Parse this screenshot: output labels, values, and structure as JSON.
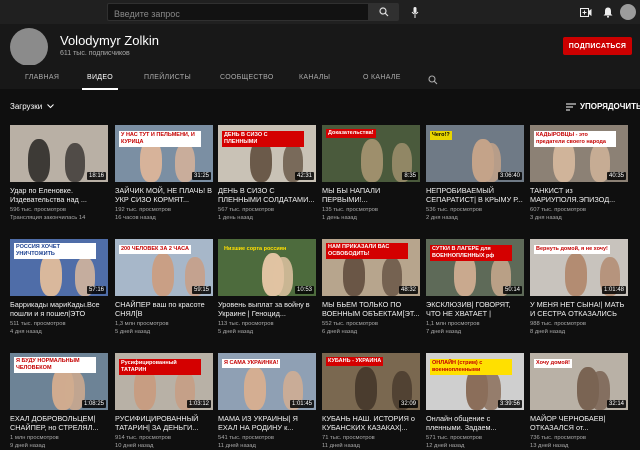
{
  "search": {
    "placeholder": "Введите запрос"
  },
  "channel": {
    "name": "Volodymyr Zolkin",
    "subscribers": "611 тыс. подписчиков",
    "subscribe_label": "ПОДПИСАТЬСЯ"
  },
  "tabs": [
    "ГЛАВНАЯ",
    "ВИДЕО",
    "ПЛЕЙЛИСТЫ",
    "СООБЩЕСТВО",
    "КАНАЛЫ",
    "О КАНАЛЕ"
  ],
  "sort": {
    "left": "Загрузки",
    "right": "УПОРЯДОЧИТЬ"
  },
  "videos": [
    {
      "title": "Удар по Еленовке. Издевательства над ...",
      "views": "596 тыс. просмотров",
      "age": "Трансляция закончилась 14",
      "duration": "18:16",
      "caption": ""
    },
    {
      "title": "ЗАЙЧИК МОЙ, НЕ ПЛАЧЬ! В УКР СИЗО КОРМЯТ...",
      "views": "192 тыс. просмотров",
      "age": "16 часов назад",
      "duration": "31:25",
      "caption": "У НАС ТУТ И ПЕЛЬМЕНИ, И КУРИЦА"
    },
    {
      "title": "ДЕНЬ В СИЗО С ПЛЕННЫМИ СОЛДАТАМИ...",
      "views": "567 тыс. просмотров",
      "age": "1 день назад",
      "duration": "42:31",
      "caption": "ДЕНЬ В СИЗО С ПЛЕННЫМИ"
    },
    {
      "title": "МЫ БЫ НАПАЛИ ПЕРВЫМИ!...",
      "views": "135 тыс. просмотров",
      "age": "1 день назад",
      "duration": "8:35",
      "caption": "Доказательства!"
    },
    {
      "title": "НЕПРОБИВАЕМЫЙ СЕПАРАТИСТ| В КРЫМУ Р...",
      "views": "536 тыс. просмотров",
      "age": "2 дня назад",
      "duration": "3:06:40",
      "caption": "Чего!?"
    },
    {
      "title": "ТАНКИСТ из МАРИУПОЛЯ.ЭПИЗОД...",
      "views": "607 тыс. просмотров",
      "age": "3 дня назад",
      "duration": "40:35",
      "caption": "КАДЫРОВЦЫ - это предатели своего народа"
    },
    {
      "title": "Баррикады мариКады.Все пошли и я пошел|ЭТО ВСЕ...",
      "views": "511 тыс. просмотров",
      "age": "4 дня назад",
      "duration": "57:16",
      "caption": "РОССИЯ ХОЧЕТ УНИЧТОЖИТЬ"
    },
    {
      "title": "СНАЙПЕР ваш по красоте СНЯЛ[В ПОДРОБНОСТЯХ]...",
      "views": "1,3 млн просмотров",
      "age": "5 дней назад",
      "duration": "59:15",
      "caption": "200 ЧЕЛОВЕК ЗА 2 ЧАСА"
    },
    {
      "title": "Уровень выплат за войну в Украине | Геноцид...",
      "views": "113 тыс. просмотров",
      "age": "5 дней назад",
      "duration": "10:53",
      "caption": "Низшие сорта россиян"
    },
    {
      "title": "МЫ БЬЕМ ТОЛЬКО ПО ВОЕННЫМ ОБЪЕКТАМ[ЭТ...",
      "views": "552 тыс. просмотров",
      "age": "6 дней назад",
      "duration": "48:32",
      "caption": "НАМ ПРИКАЗАЛИ ВАС ОСВОБОДИТЬ!"
    },
    {
      "title": "ЭКСКЛЮЗИВ| ГОВОРЯТ, ЧТО НЕ ХВАТАЕТ | УСЛОВИ...",
      "views": "1,1 млн просмотров",
      "age": "7 дней назад",
      "duration": "50:14",
      "caption": "СУТКИ В ЛАГЕРЕ для ВОЕННОПЛЕННЫХ рф"
    },
    {
      "title": "У МЕНЯ НЕТ СЫНА!| МАТЬ И СЕСТРА ОТКАЗАЛИСЬ о...",
      "views": "988 тыс. просмотров",
      "age": "8 дней назад",
      "duration": "1:01:48",
      "caption": "Вернуть домой, я не хочу!"
    },
    {
      "title": "ЕХАЛ ДОБРОВОЛЬЦЕМ| СНАЙПЕР, но СТРЕЛЯЛ...",
      "views": "1 млн просмотров",
      "age": "9 дней назад",
      "duration": "1:08:25",
      "caption": "Я БУДУ НОРМАЛЬНЫМ ЧЕЛОВЕКОМ"
    },
    {
      "title": "РУСИФИЦИРОВАННЫЙ ТАТАРИН| ЗА ДЕНЬГИ...",
      "views": "914 тыс. просмотров",
      "age": "10 дней назад",
      "duration": "1:03:12",
      "caption": "Русифицированный ТАТАРИН"
    },
    {
      "title": "МАМА ИЗ УКРАИНЫ| Я ЕХАЛ НА РОДИНУ к...",
      "views": "541 тыс. просмотров",
      "age": "11 дней назад",
      "duration": "1:01:45",
      "caption": "Я САМА УКРАИНКА!"
    },
    {
      "title": "КУБАНЬ НАШ. ИСТОРИЯ о КУБАНСКИХ КАЗАКАХ|...",
      "views": "71 тыс. просмотров",
      "age": "11 дней назад",
      "duration": "32:09",
      "caption": "КУБАНЬ - УКРАИНА"
    },
    {
      "title": "Онлайн общение с пленными. Задаем...",
      "views": "571 тыс. просмотров",
      "age": "12 дней назад",
      "duration": "3:39:56",
      "caption": "ОНЛАЙН (стрим) с военнопленными"
    },
    {
      "title": "МАЙОР ЧЕРНОБАЕВ| ОТКАЗАЛСЯ от...",
      "views": "736 тыс. просмотров",
      "age": "13 дней назад",
      "duration": "32:14",
      "caption": "Хочу домой!"
    }
  ],
  "thumb_colors": [
    {
      "bg": "#b9b0a5",
      "fg": "#3d3a36",
      "cap_bg": "",
      "cap_fg": ""
    },
    {
      "bg": "#7b8fa3",
      "fg": "#d7b39a",
      "cap_bg": "#ffffff",
      "cap_fg": "#c40000"
    },
    {
      "bg": "#c9c2b6",
      "fg": "#6b5a4a",
      "cap_bg": "#d40000",
      "cap_fg": "#ffffff"
    },
    {
      "bg": "#4a5a3c",
      "fg": "#9e8f6c",
      "cap_bg": "#d40000",
      "cap_fg": "#ffffff"
    },
    {
      "bg": "#6f7a86",
      "fg": "#c4a389",
      "cap_bg": "#e8d400",
      "cap_fg": "#000000"
    },
    {
      "bg": "#8c8175",
      "fg": "#d0b49a",
      "cap_bg": "#ffffff",
      "cap_fg": "#c40000"
    },
    {
      "bg": "#4f6da8",
      "fg": "#d9b89c",
      "cap_bg": "#ffffff",
      "cap_fg": "#1a3f8f"
    },
    {
      "bg": "#a7b7c9",
      "fg": "#c99f85",
      "cap_bg": "#ffffff",
      "cap_fg": "#c40000"
    },
    {
      "bg": "#4d6b3d",
      "fg": "#e0c3a2",
      "cap_bg": "transparent",
      "cap_fg": "#ffe000"
    },
    {
      "bg": "#b7a58d",
      "fg": "#6a5646",
      "cap_bg": "#d40000",
      "cap_fg": "#ffffff"
    },
    {
      "bg": "#5e6a58",
      "fg": "#c9a98e",
      "cap_bg": "#d40000",
      "cap_fg": "#ffffff"
    },
    {
      "bg": "#c8c3bd",
      "fg": "#b38c72",
      "cap_bg": "#ffffff",
      "cap_fg": "#c40000"
    },
    {
      "bg": "#6d8396",
      "fg": "#d0ab8f",
      "cap_bg": "#ffffff",
      "cap_fg": "#c40000"
    },
    {
      "bg": "#b8b1a6",
      "fg": "#c79d82",
      "cap_bg": "#d40000",
      "cap_fg": "#ffffff"
    },
    {
      "bg": "#8fa0b4",
      "fg": "#d4ae92",
      "cap_bg": "#ffffff",
      "cap_fg": "#c40000"
    },
    {
      "bg": "#7a6850",
      "fg": "#4a3c2e",
      "cap_bg": "#d40000",
      "cap_fg": "#ffffff"
    },
    {
      "bg": "#cfcfcf",
      "fg": "#8b6e5a",
      "cap_bg": "#ffe000",
      "cap_fg": "#c40000"
    },
    {
      "bg": "#b9b1a6",
      "fg": "#7a6453",
      "cap_bg": "#ffffff",
      "cap_fg": "#c40000"
    }
  ]
}
